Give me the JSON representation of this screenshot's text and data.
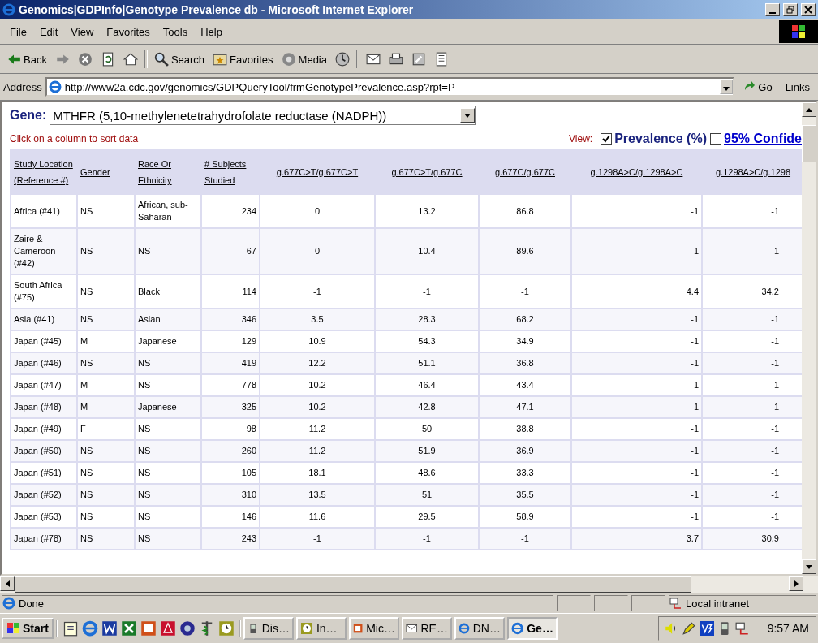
{
  "window": {
    "title": "Genomics|GDPInfo|Genotype Prevalence db - Microsoft Internet Explorer"
  },
  "menu": [
    "File",
    "Edit",
    "View",
    "Favorites",
    "Tools",
    "Help"
  ],
  "toolbar": [
    {
      "kind": "back",
      "label": "Back"
    },
    {
      "kind": "forward"
    },
    {
      "kind": "stop"
    },
    {
      "kind": "refresh"
    },
    {
      "kind": "home"
    },
    {
      "kind": "search",
      "label": "Search"
    },
    {
      "kind": "favorites",
      "label": "Favorites"
    },
    {
      "kind": "media",
      "label": "Media"
    },
    {
      "kind": "history"
    },
    {
      "kind": "mail"
    },
    {
      "kind": "print"
    },
    {
      "kind": "edit"
    },
    {
      "kind": "discuss"
    }
  ],
  "address": {
    "label": "Address",
    "value": "http://www2a.cdc.gov/genomics/GDPQueryTool/frmGenotypePrevalence.asp?rpt=P",
    "go": "Go",
    "links": "Links"
  },
  "page": {
    "gene_label": "Gene:",
    "gene_value": "MTHFR (5,10-methylenetetrahydrofolate reductase (NADPH))",
    "sort_hint": "Click on a column to sort data",
    "view_label": "View:",
    "view_options": [
      {
        "kind": "label",
        "label": "Prevalence (%)",
        "checked": true
      },
      {
        "kind": "link",
        "label": "95% Confide",
        "checked": false
      }
    ],
    "table": {
      "columns": [
        "Study Location (Reference #)",
        "Gender",
        "Race Or Ethnicity",
        "# Subjects Studied",
        "g.677C>T/g.677C>T",
        "g.677C>T/g.677C",
        "g.677C/g.677C",
        "g.1298A>C/g.1298A>C",
        "g.1298A>C/g.1298"
      ],
      "rows": [
        [
          "Africa (#41)",
          "NS",
          "African, sub-Saharan",
          "234",
          "0",
          "13.2",
          "86.8",
          "-1",
          "-1"
        ],
        [
          "Zaire & Cameroon (#42)",
          "NS",
          "NS",
          "67",
          "0",
          "10.4",
          "89.6",
          "-1",
          "-1"
        ],
        [
          "South Africa (#75)",
          "NS",
          "Black",
          "114",
          "-1",
          "-1",
          "-1",
          "4.4",
          "34.2"
        ],
        [
          "Asia (#41)",
          "NS",
          "Asian",
          "346",
          "3.5",
          "28.3",
          "68.2",
          "-1",
          "-1"
        ],
        [
          "Japan (#45)",
          "M",
          "Japanese",
          "129",
          "10.9",
          "54.3",
          "34.9",
          "-1",
          "-1"
        ],
        [
          "Japan (#46)",
          "NS",
          "NS",
          "419",
          "12.2",
          "51.1",
          "36.8",
          "-1",
          "-1"
        ],
        [
          "Japan (#47)",
          "M",
          "NS",
          "778",
          "10.2",
          "46.4",
          "43.4",
          "-1",
          "-1"
        ],
        [
          "Japan (#48)",
          "M",
          "Japanese",
          "325",
          "10.2",
          "42.8",
          "47.1",
          "-1",
          "-1"
        ],
        [
          "Japan (#49)",
          "F",
          "NS",
          "98",
          "11.2",
          "50",
          "38.8",
          "-1",
          "-1"
        ],
        [
          "Japan (#50)",
          "NS",
          "NS",
          "260",
          "11.2",
          "51.9",
          "36.9",
          "-1",
          "-1"
        ],
        [
          "Japan (#51)",
          "NS",
          "NS",
          "105",
          "18.1",
          "48.6",
          "33.3",
          "-1",
          "-1"
        ],
        [
          "Japan (#52)",
          "NS",
          "NS",
          "310",
          "13.5",
          "51",
          "35.5",
          "-1",
          "-1"
        ],
        [
          "Japan (#53)",
          "NS",
          "NS",
          "146",
          "11.6",
          "29.5",
          "58.9",
          "-1",
          "-1"
        ],
        [
          "Japan (#78)",
          "NS",
          "NS",
          "243",
          "-1",
          "-1",
          "-1",
          "3.7",
          "30.9"
        ]
      ]
    }
  },
  "status_bar": {
    "text": "Done",
    "zone": "Local intranet"
  },
  "taskbar": {
    "start": "Start",
    "tasks": [
      {
        "kind": "palm",
        "label": "Dis…",
        "selected": false
      },
      {
        "kind": "clock",
        "label": "In…",
        "selected": false
      },
      {
        "kind": "powerpoint",
        "label": "Mic…",
        "selected": false
      },
      {
        "kind": "mail",
        "label": "RE…",
        "selected": false
      },
      {
        "kind": "ie",
        "label": "DN…",
        "selected": false
      },
      {
        "kind": "ie",
        "label": "Ge…",
        "selected": true
      }
    ],
    "clock": "9:57 AM"
  }
}
